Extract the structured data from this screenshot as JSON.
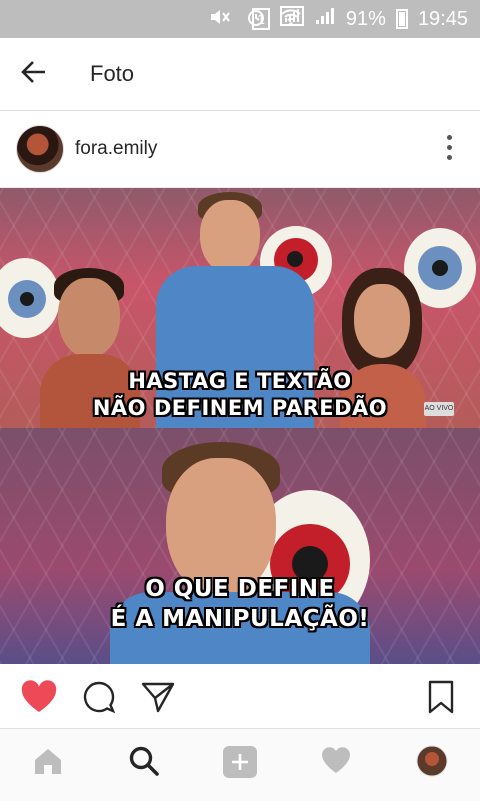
{
  "status_bar": {
    "battery": "91%",
    "time": "19:45",
    "sim_badge": "1"
  },
  "app_bar": {
    "title": "Foto"
  },
  "post": {
    "username": "fora.emily",
    "caption_top_line1": "HASTAG E TEXTÃO",
    "caption_top_line2": "NÃO DEFINEM PAREDÃO",
    "caption_bottom_line1": "O QUE DEFINE",
    "caption_bottom_line2": "É A MANIPULAÇÃO!",
    "live_badge": "AO VIVO"
  },
  "actions": {
    "liked": true,
    "like_color": "#ed4956"
  },
  "bottom_nav": {
    "items": [
      "home-icon",
      "search-icon",
      "add-icon",
      "activity-icon",
      "profile-icon"
    ],
    "active": "search-icon"
  }
}
